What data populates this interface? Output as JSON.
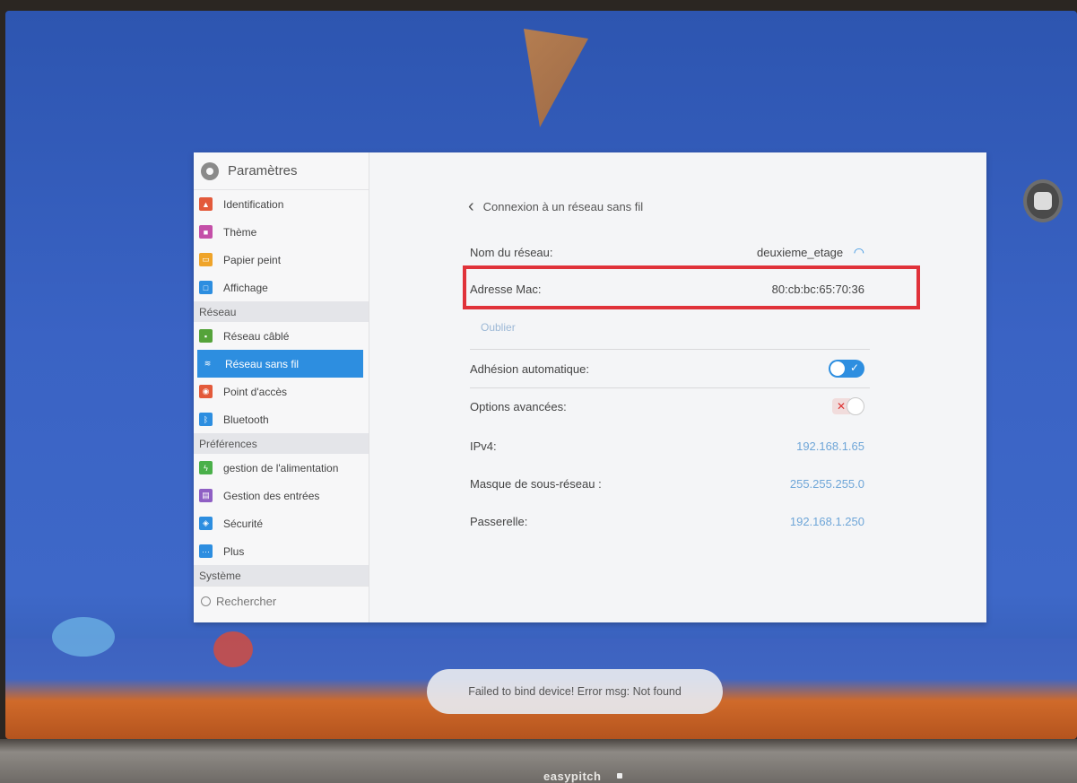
{
  "settings": {
    "title": "Paramètres",
    "sidebar": {
      "items": [
        {
          "label": "Identification",
          "icon": "identification-icon",
          "color": "#e35a3b"
        },
        {
          "label": "Thème",
          "icon": "theme-icon",
          "color": "#c44fa8"
        },
        {
          "label": "Papier peint",
          "icon": "wallpaper-icon",
          "color": "#efa42a"
        },
        {
          "label": "Affichage",
          "icon": "display-icon",
          "color": "#2d8ee0"
        }
      ],
      "section_reseau": "Réseau",
      "network_items": [
        {
          "label": "Réseau câblé",
          "icon": "ethernet-icon",
          "color": "#55a33a"
        },
        {
          "label": "Réseau sans fil",
          "icon": "wifi-icon",
          "color": "#2d8ee0",
          "active": true
        },
        {
          "label": "Point d'accès",
          "icon": "hotspot-icon",
          "color": "#e35a3b"
        },
        {
          "label": "Bluetooth",
          "icon": "bluetooth-icon",
          "color": "#2d8ee0"
        }
      ],
      "section_preferences": "Préférences",
      "pref_items": [
        {
          "label": "gestion de l'alimentation",
          "icon": "power-icon",
          "color": "#4ab04a"
        },
        {
          "label": "Gestion des entrées",
          "icon": "input-icon",
          "color": "#8f5fc4"
        },
        {
          "label": "Sécurité",
          "icon": "security-icon",
          "color": "#2d8ee0"
        },
        {
          "label": "Plus",
          "icon": "more-icon",
          "color": "#2d8ee0"
        }
      ],
      "section_systeme": "Système",
      "search_label": "Rechercher"
    },
    "main": {
      "back_title": "Connexion à un réseau sans fil",
      "network_name_label": "Nom du réseau:",
      "network_name_value": "deuxieme_etage",
      "mac_label": "Adresse Mac:",
      "mac_value": "80:cb:bc:65:70:36",
      "forget_label": "Oublier",
      "auto_join_label": "Adhésion automatique:",
      "auto_join_on": true,
      "advanced_label": "Options avancées:",
      "advanced_on": false,
      "ipv4_label": "IPv4:",
      "ipv4_value": "192.168.1.65",
      "mask_label": "Masque de sous-réseau :",
      "mask_value": "255.255.255.0",
      "gateway_label": "Passerelle:",
      "gateway_value": "192.168.1.250"
    }
  },
  "toast": {
    "message": "Failed to bind device! Error msg: Not found"
  },
  "bezel": {
    "brand": "easypitch"
  },
  "colors": {
    "accent": "#2d8ee0",
    "highlight": "#e0323a",
    "desktop": "#3a63c4"
  }
}
